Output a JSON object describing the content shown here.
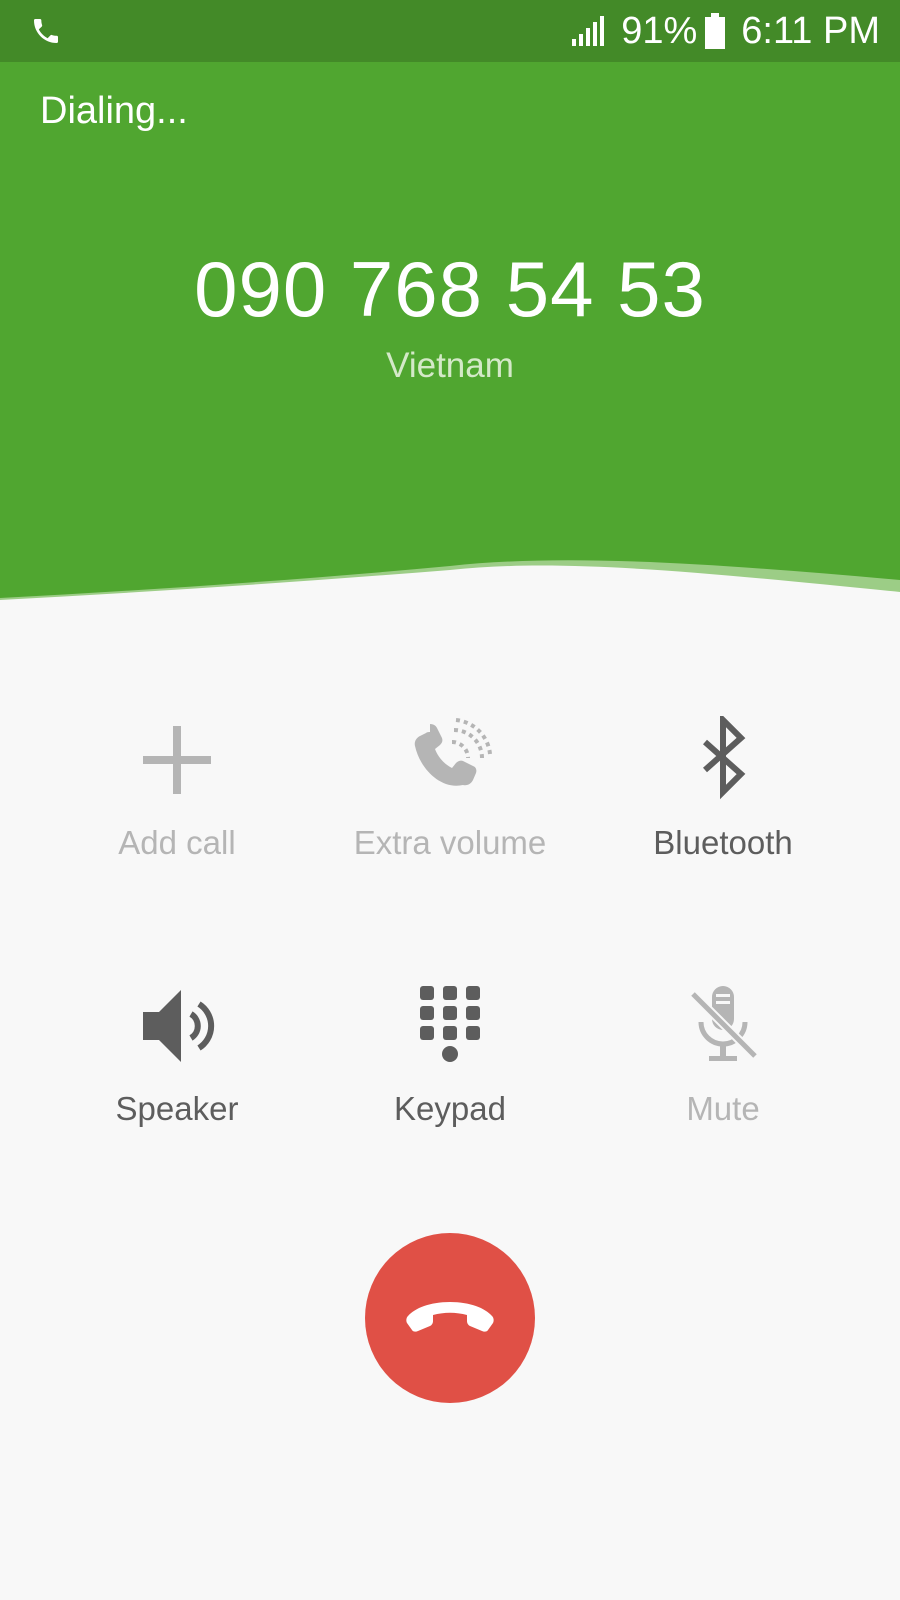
{
  "status_bar": {
    "battery": "91%",
    "time": "6:11 PM",
    "icons": [
      "phone-call-icon",
      "signal-icon",
      "battery-icon"
    ]
  },
  "call": {
    "state": "Dialing...",
    "number": "090 768 54 53",
    "country": "Vietnam"
  },
  "actions": [
    {
      "label": "Add call",
      "icon": "plus-icon",
      "enabled": false
    },
    {
      "label": "Extra volume",
      "icon": "extra-volume-icon",
      "enabled": false
    },
    {
      "label": "Bluetooth",
      "icon": "bluetooth-icon",
      "enabled": true
    },
    {
      "label": "Speaker",
      "icon": "speaker-icon",
      "enabled": true
    },
    {
      "label": "Keypad",
      "icon": "keypad-icon",
      "enabled": true
    },
    {
      "label": "Mute",
      "icon": "mute-icon",
      "enabled": false
    }
  ],
  "end_call": {
    "icon": "end-call-icon"
  },
  "colors": {
    "header_green": "#50a630",
    "status_green": "#438a28",
    "end_call_red": "#e05046",
    "enabled_icon": "#5d5d5d",
    "disabled_icon": "#b5b5b5",
    "background": "#f8f8f8"
  }
}
